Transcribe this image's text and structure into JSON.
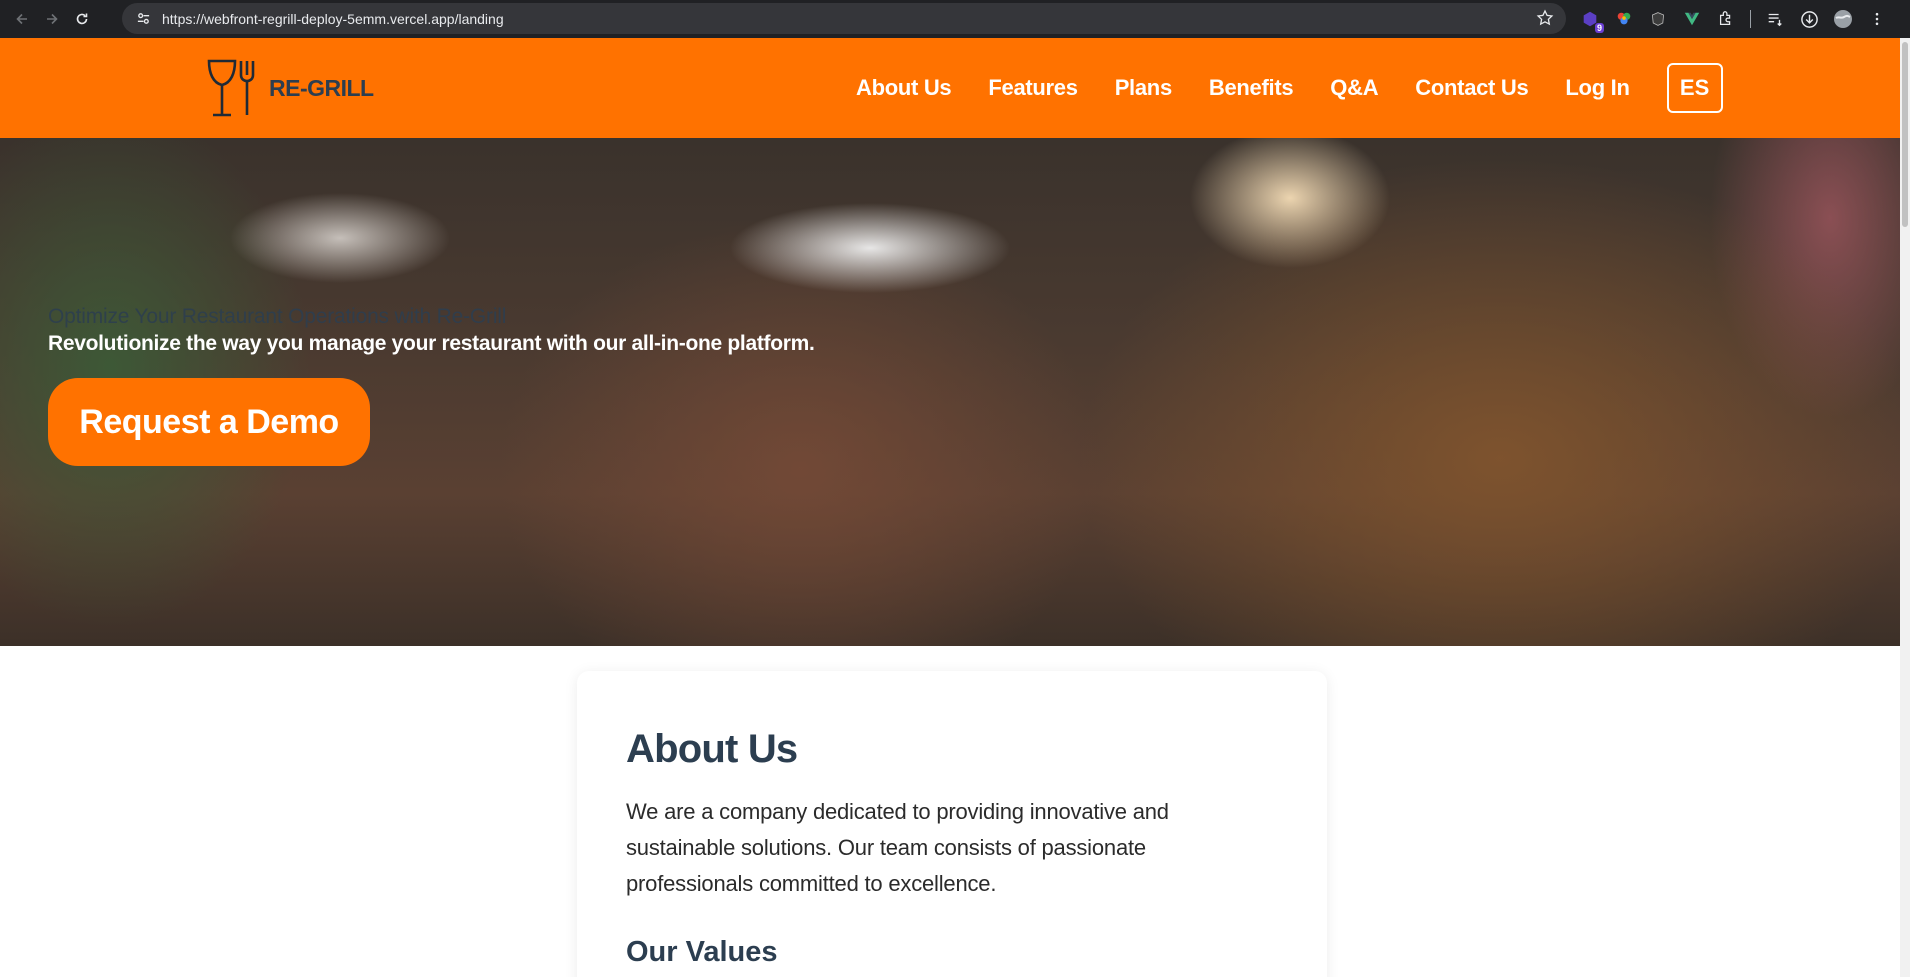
{
  "browser": {
    "url": "https://webfront-regrill-deploy-5emm.vercel.app/landing",
    "extension_badge": "9"
  },
  "header": {
    "brand": "RE-GRILL",
    "nav": [
      {
        "label": "About Us"
      },
      {
        "label": "Features"
      },
      {
        "label": "Plans"
      },
      {
        "label": "Benefits"
      },
      {
        "label": "Q&A"
      },
      {
        "label": "Contact Us"
      },
      {
        "label": "Log In"
      }
    ],
    "language_button": "ES",
    "colors": {
      "header_bg": "#ff7200",
      "brand_text": "#2c3e50"
    }
  },
  "hero": {
    "title": "Optimize Your Restaurant Operations with Re-Grill",
    "subtitle": "Revolutionize the way you manage your restaurant with our all-in-one platform.",
    "cta_label": "Request a Demo"
  },
  "about": {
    "title": "About Us",
    "text": "We are a company dedicated to providing innovative and sustainable solutions. Our team consists of passionate professionals committed to excellence.",
    "values_title": "Our Values"
  },
  "icons": [
    "back-icon",
    "forward-icon",
    "reload-icon",
    "site-settings-icon",
    "bookmark-star-icon",
    "extensions-icon",
    "downloads-icon",
    "profile-icon",
    "menu-icon",
    "fork-glass-logo-icon"
  ]
}
